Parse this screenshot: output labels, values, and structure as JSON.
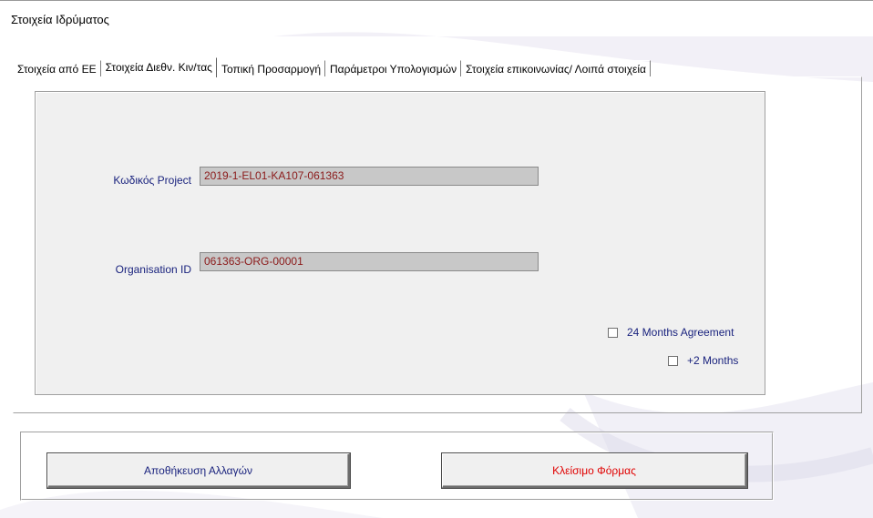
{
  "window": {
    "title": "Στοιχεία Ιδρύματος"
  },
  "tabs": [
    {
      "label": "Στοιχεία από ΕΕ",
      "active": false
    },
    {
      "label": "Στοιχεία Διεθν. Κιν/τας",
      "active": true
    },
    {
      "label": "Τοπική Προσαρμογή",
      "active": false
    },
    {
      "label": "Παράμετροι Υπολογισμών",
      "active": false
    },
    {
      "label": "Στοιχεία επικοινωνίας/ Λοιπά στοιχεία",
      "active": false
    }
  ],
  "form": {
    "project_code_label": "Κωδικός Project",
    "project_code_value": "2019-1-EL01-KA107-061363",
    "organisation_id_label": "Organisation ID",
    "organisation_id_value": "061363-ORG-00001",
    "months24_label": "24 Months Agreement",
    "months24_checked": false,
    "plus2_label": "+2 Months",
    "plus2_checked": false
  },
  "actions": {
    "save_label": "Αποθήκευση Αλλαγών",
    "close_label": "Κλείσιμο Φόρμας"
  },
  "colors": {
    "label_text": "#1a237e",
    "input_text": "#8b1a1a",
    "input_bg": "#c8c8c8",
    "close_text": "#e00000",
    "panel_bg": "#f0f0f0"
  }
}
